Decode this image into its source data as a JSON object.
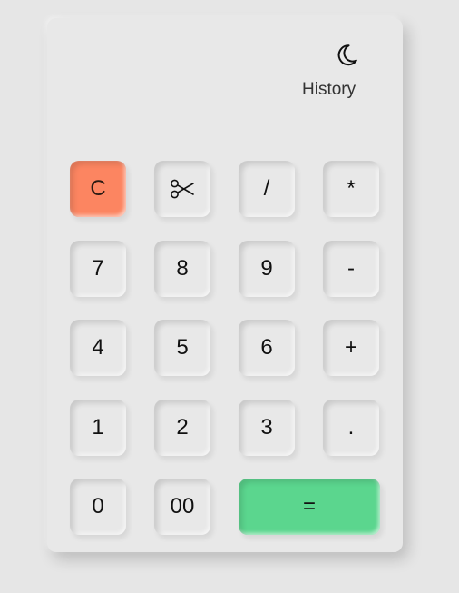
{
  "header": {
    "theme_icon": "moon-icon",
    "history_label": "History"
  },
  "display": {
    "value": ""
  },
  "keys": {
    "clear": "C",
    "cut_icon": "scissors-icon",
    "divide": "/",
    "multiply": "*",
    "seven": "7",
    "eight": "8",
    "nine": "9",
    "minus": "-",
    "four": "4",
    "five": "5",
    "six": "6",
    "plus": "+",
    "one": "1",
    "two": "2",
    "three": "3",
    "decimal": ".",
    "zero": "0",
    "double_zero": "00",
    "equals": "="
  },
  "colors": {
    "background": "#e6e6e6",
    "clear_key": "#fc8561",
    "equals_key": "#5bd68e"
  }
}
